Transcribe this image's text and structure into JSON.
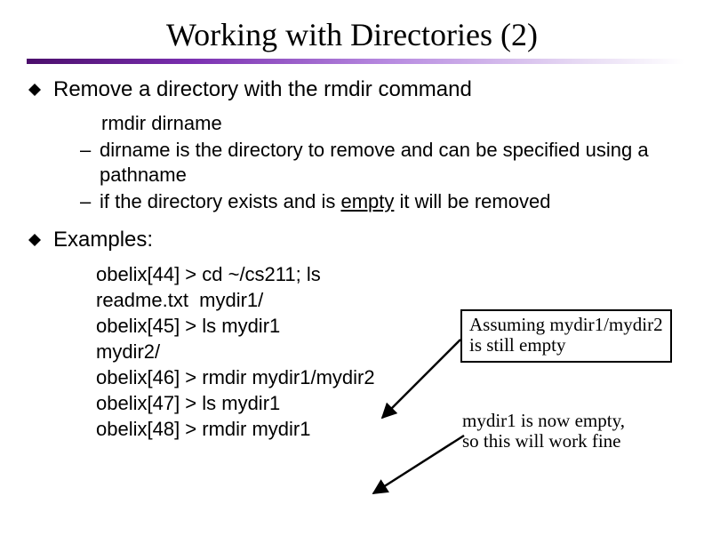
{
  "title": "Working with Directories (2)",
  "bullet1": "Remove a directory with the rmdir command",
  "code1": "rmdir  dirname",
  "sub1": "dirname is the directory to remove and can be specified using a pathname",
  "sub2_pre": "if the directory exists and is ",
  "sub2_u": "empty",
  "sub2_post": " it will be removed",
  "bullet2": "Examples:",
  "ex": {
    "l1": "obelix[44] > cd ~/cs211; ls",
    "l2": "readme.txt  mydir1/",
    "l3": "obelix[45] > ls mydir1",
    "l4": "mydir2/",
    "l5": "obelix[46] > rmdir mydir1/mydir2",
    "l6": "obelix[47] > ls mydir1",
    "l7": "obelix[48] > rmdir mydir1"
  },
  "callout1_l1": "Assuming mydir1/mydir2",
  "callout1_l2": "is still empty",
  "callout2_l1": "mydir1 is now empty,",
  "callout2_l2": "so this will work fine"
}
